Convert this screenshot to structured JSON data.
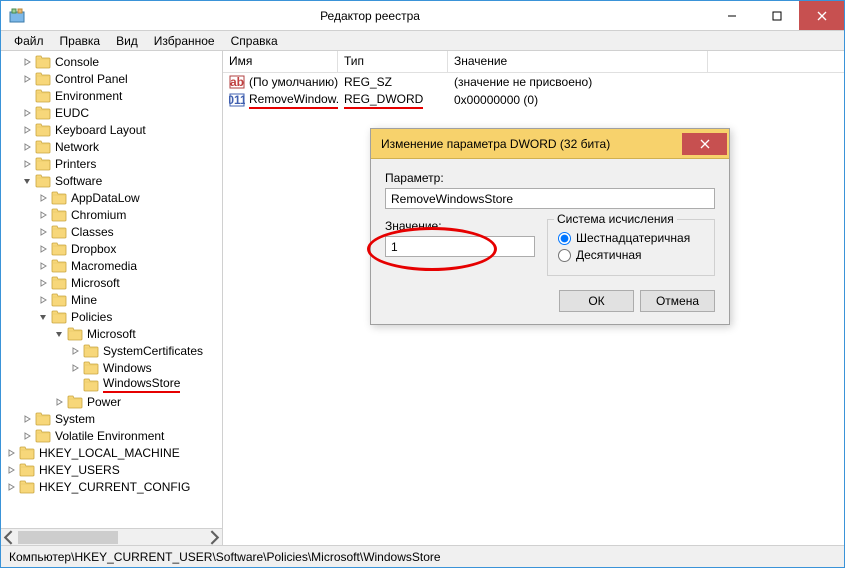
{
  "window": {
    "title": "Редактор реестра"
  },
  "menu": {
    "file": "Файл",
    "edit": "Правка",
    "view": "Вид",
    "favorites": "Избранное",
    "help": "Справка"
  },
  "tree": [
    {
      "label": "Console",
      "depth": 1,
      "exp": "closed"
    },
    {
      "label": "Control Panel",
      "depth": 1,
      "exp": "closed"
    },
    {
      "label": "Environment",
      "depth": 1,
      "exp": "none"
    },
    {
      "label": "EUDC",
      "depth": 1,
      "exp": "closed"
    },
    {
      "label": "Keyboard Layout",
      "depth": 1,
      "exp": "closed"
    },
    {
      "label": "Network",
      "depth": 1,
      "exp": "closed"
    },
    {
      "label": "Printers",
      "depth": 1,
      "exp": "closed"
    },
    {
      "label": "Software",
      "depth": 1,
      "exp": "open"
    },
    {
      "label": "AppDataLow",
      "depth": 2,
      "exp": "closed"
    },
    {
      "label": "Chromium",
      "depth": 2,
      "exp": "closed"
    },
    {
      "label": "Classes",
      "depth": 2,
      "exp": "closed"
    },
    {
      "label": "Dropbox",
      "depth": 2,
      "exp": "closed"
    },
    {
      "label": "Macromedia",
      "depth": 2,
      "exp": "closed"
    },
    {
      "label": "Microsoft",
      "depth": 2,
      "exp": "closed"
    },
    {
      "label": "Mine",
      "depth": 2,
      "exp": "closed"
    },
    {
      "label": "Policies",
      "depth": 2,
      "exp": "open"
    },
    {
      "label": "Microsoft",
      "depth": 3,
      "exp": "open"
    },
    {
      "label": "SystemCertificates",
      "depth": 4,
      "exp": "closed"
    },
    {
      "label": "Windows",
      "depth": 4,
      "exp": "closed"
    },
    {
      "label": "WindowsStore",
      "depth": 4,
      "exp": "none",
      "underline": true
    },
    {
      "label": "Power",
      "depth": 3,
      "exp": "closed"
    },
    {
      "label": "System",
      "depth": 1,
      "exp": "closed"
    },
    {
      "label": "Volatile Environment",
      "depth": 1,
      "exp": "closed"
    },
    {
      "label": "HKEY_LOCAL_MACHINE",
      "depth": 0,
      "exp": "closed"
    },
    {
      "label": "HKEY_USERS",
      "depth": 0,
      "exp": "closed"
    },
    {
      "label": "HKEY_CURRENT_CONFIG",
      "depth": 0,
      "exp": "closed"
    }
  ],
  "list": {
    "cols": {
      "name": "Имя",
      "type": "Тип",
      "value": "Значение"
    },
    "col_widths": {
      "name": 115,
      "type": 110,
      "value": 260
    },
    "rows": [
      {
        "icon": "ab",
        "name": "(По умолчанию)",
        "type": "REG_SZ",
        "value": "(значение не присвоено)"
      },
      {
        "icon": "01",
        "name": "RemoveWindow...",
        "type": "REG_DWORD",
        "value": "0x00000000 (0)",
        "underline": true
      }
    ]
  },
  "dialog": {
    "title": "Изменение параметра DWORD (32 бита)",
    "param_label": "Параметр:",
    "param_value": "RemoveWindowsStore",
    "value_label": "Значение:",
    "value_value": "1",
    "base_label": "Система исчисления",
    "radio_hex": "Шестнадцатеричная",
    "radio_dec": "Десятичная",
    "ok": "ОК",
    "cancel": "Отмена"
  },
  "statusbar": "Компьютер\\HKEY_CURRENT_USER\\Software\\Policies\\Microsoft\\WindowsStore"
}
